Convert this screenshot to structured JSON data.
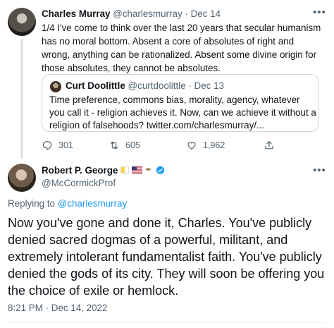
{
  "parent_tweet": {
    "author_name": "Charles Murray",
    "author_handle": "@charlesmurray",
    "separator": "·",
    "date": "Dec 14",
    "text": "1/4 I've come to think over the last 20 years that secular humanism has no moral bottom. Absent a core of absolutes of right and wrong, anything can be rationalized. Absent some divine origin for those absolutes, they cannot be absolutes.",
    "quoted_tweet": {
      "author_name": "Curt Doolittle",
      "author_handle": "@curtdoolittle",
      "separator": "·",
      "date": "Dec 13",
      "text": "Time preference, commons bias, morality, agency, whatever you call it - religion achieves it. Now, can we achieve it without a religion of falsehoods? twitter.com/charlesmurray/..."
    },
    "actions": {
      "reply_count": "301",
      "retweet_count": "605",
      "like_count": "1,962"
    }
  },
  "main_tweet": {
    "author_name": "Robert P. George",
    "author_handle": "@McCormickProf",
    "replying_prefix": "Replying to",
    "replying_to": "@charlesmurray",
    "text": "Now you've gone and done it, Charles. You've publicly denied sacred dogmas of a powerful, militant, and extremely intolerant fundamentalist faith. You've publicly denied the gods of its city. They will soon be offering you the choice of exile or hemlock.",
    "timestamp": "8:21 PM · Dec 14, 2022"
  },
  "icons": {
    "more": "more-horizontal-icon",
    "reply": "reply-icon",
    "retweet": "retweet-icon",
    "like": "heart-icon",
    "share": "share-icon",
    "verified": "verified-badge-icon"
  },
  "colors": {
    "text": "#0f1419",
    "secondary": "#536471",
    "accent": "#1d9bf0",
    "border": "#cfd9de"
  }
}
